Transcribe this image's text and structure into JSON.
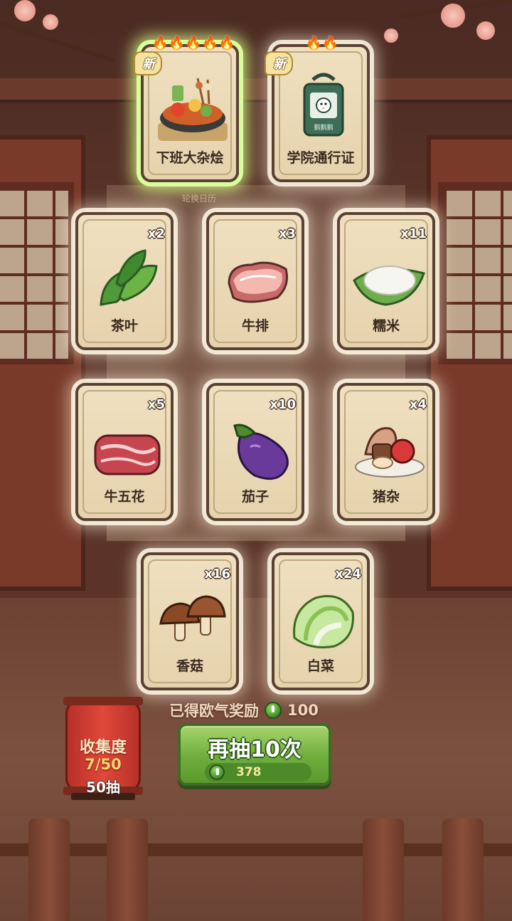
{
  "featured_cards": [
    {
      "name": "下班大杂烩",
      "new_tag": "新",
      "flames": 5
    },
    {
      "name": "学院通行证",
      "new_tag": "新",
      "flames": 2,
      "badge_text": "鹅鹅鹅"
    }
  ],
  "rotate_label": "轮换日历",
  "items": [
    {
      "name": "茶叶",
      "count": "x2",
      "icon": "tea-leaf-icon"
    },
    {
      "name": "牛排",
      "count": "x3",
      "icon": "steak-icon"
    },
    {
      "name": "糯米",
      "count": "x11",
      "icon": "sticky-rice-icon"
    },
    {
      "name": "牛五花",
      "count": "x5",
      "icon": "beef-belly-icon"
    },
    {
      "name": "茄子",
      "count": "x10",
      "icon": "eggplant-icon"
    },
    {
      "name": "猪杂",
      "count": "x4",
      "icon": "pork-offal-icon"
    },
    {
      "name": "香菇",
      "count": "x16",
      "icon": "mushroom-icon"
    },
    {
      "name": "白菜",
      "count": "x24",
      "icon": "cabbage-icon"
    }
  ],
  "reward": {
    "label": "已得欧气奖励",
    "value": "100"
  },
  "draw_button": {
    "label": "再抽10次",
    "cost": "378"
  },
  "collection": {
    "title": "收集度",
    "progress": "7/50",
    "draws": "50抽"
  },
  "colors": {
    "accent_green": "#6fad3d",
    "lantern_red": "#e0483a",
    "card_bg": "#efe0c0"
  }
}
